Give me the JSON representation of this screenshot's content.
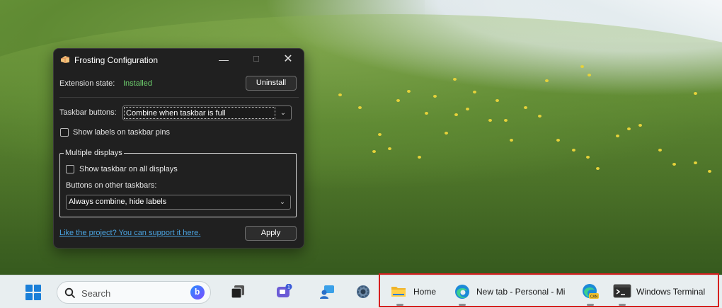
{
  "window": {
    "title": "Frosting Configuration",
    "extension_state_label": "Extension state:",
    "extension_state_value": "Installed",
    "uninstall_label": "Uninstall",
    "taskbar_buttons_label": "Taskbar buttons:",
    "taskbar_buttons_value": "Combine when taskbar is full",
    "show_labels_pins_label": "Show labels on taskbar pins",
    "show_labels_pins_checked": false,
    "multiple_displays": {
      "legend": "Multiple displays",
      "show_all_displays_label": "Show taskbar on all displays",
      "show_all_displays_checked": false,
      "other_taskbars_label": "Buttons on other taskbars:",
      "other_taskbars_value": "Always combine, hide labels"
    },
    "support_link": "Like the project? You can support it here.",
    "apply_label": "Apply",
    "colors": {
      "background": "#202020",
      "accent_installed": "#6ed06e",
      "link": "#4aa3e0"
    }
  },
  "taskbar": {
    "search_placeholder": "Search",
    "chat_badge": "1",
    "apps": [
      {
        "label": "Home",
        "icon": "file-explorer-icon"
      },
      {
        "label": "New tab - Personal - Mi",
        "icon": "edge-icon"
      },
      {
        "label": "",
        "icon": "edge-canary-icon"
      },
      {
        "label": "Windows Terminal",
        "icon": "terminal-icon"
      }
    ],
    "highlight_color": "#d62020"
  }
}
